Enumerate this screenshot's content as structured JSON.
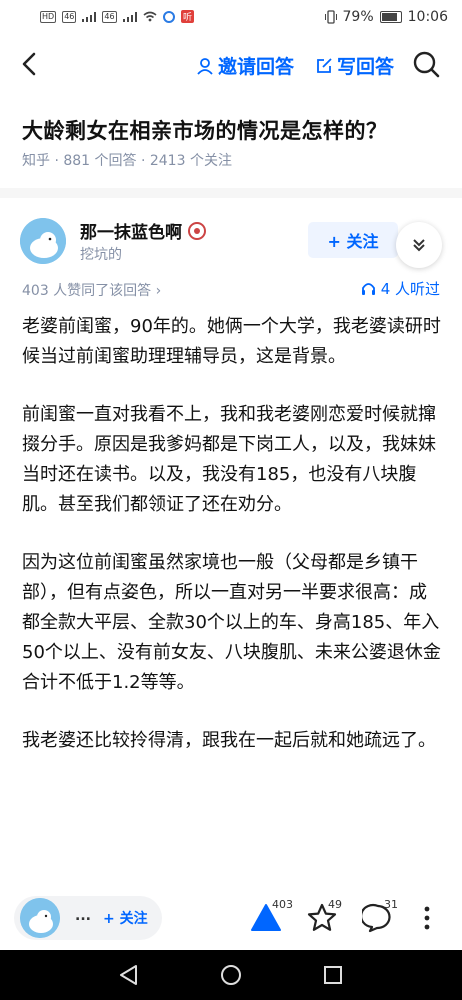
{
  "status_bar": {
    "signal_badges": [
      "HD",
      "46",
      "46"
    ],
    "battery": "79%",
    "time": "10:06"
  },
  "header": {
    "invite_label": "邀请回答",
    "write_label": "写回答"
  },
  "question": {
    "title": "大龄剩女在相亲市场的情况是怎样的？",
    "meta": "知乎 · 881 个回答 · 2413 个关注"
  },
  "answer": {
    "author_name": "那一抹蓝色啊",
    "author_bio": "挖坑的",
    "follow_label": "+ 关注",
    "votes_text": "403 人赞同了该回答 ›",
    "listen_text": "4 人听过",
    "paragraphs": [
      "老婆前闺蜜，90年的。她俩一个大学，我老婆读研时候当过前闺蜜助理理辅导员，这是背景。",
      "前闺蜜一直对我看不上，我和我老婆刚恋爱时候就撺掇分手。原因是我爹妈都是下岗工人，以及，我妹妹当时还在读书。以及，我没有185，也没有八块腹肌。甚至我们都领证了还在劝分。",
      "因为这位前闺蜜虽然家境也一般（父母都是乡镇干部），但有点姿色，所以一直对另一半要求很高：成都全款大平层、全款30个以上的车、身高185、年入50个以上、没有前女友、八块腹肌、未来公婆退休金合计不低于1.2等等。",
      "我老婆还比较拎得清，跟我在一起后就和她疏远了。"
    ]
  },
  "bottom_bar": {
    "name_truncated": "...",
    "follow_label": "+ 关注",
    "upvotes": "403",
    "favorites": "49",
    "comments": "31"
  },
  "colors": {
    "accent": "#0066ff",
    "meta": "#8590a6"
  }
}
